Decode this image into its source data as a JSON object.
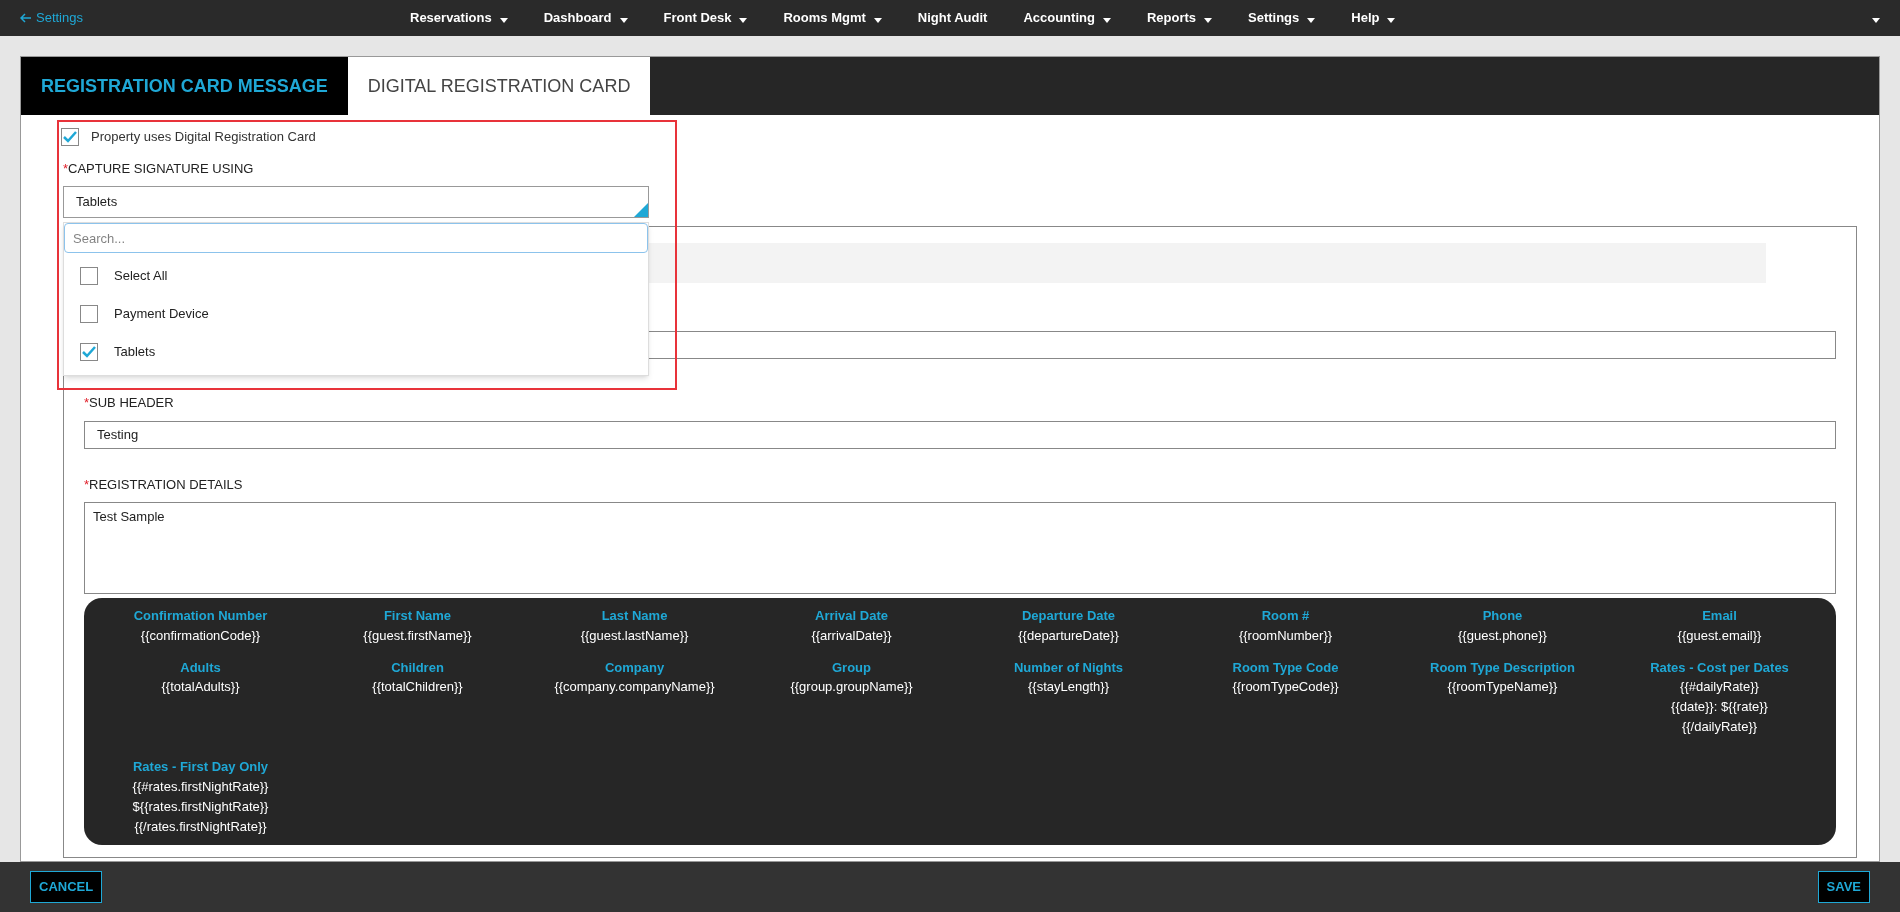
{
  "nav": {
    "back_link": "Settings",
    "menus": [
      {
        "label": "Reservations",
        "has_menu": true
      },
      {
        "label": "Dashboard",
        "has_menu": true
      },
      {
        "label": "Front Desk",
        "has_menu": true
      },
      {
        "label": "Rooms Mgmt",
        "has_menu": true
      },
      {
        "label": "Night Audit",
        "has_menu": false
      },
      {
        "label": "Accounting",
        "has_menu": true
      },
      {
        "label": "Reports",
        "has_menu": true
      },
      {
        "label": "Settings",
        "has_menu": true
      },
      {
        "label": "Help",
        "has_menu": true
      }
    ]
  },
  "tabs": [
    {
      "label": "REGISTRATION CARD MESSAGE",
      "selected": false
    },
    {
      "label": "DIGITAL REGISTRATION CARD",
      "selected": true
    }
  ],
  "property_checkbox": {
    "label": "Property uses Digital Registration Card",
    "checked": true
  },
  "capture_field": {
    "marker": "*",
    "label": "CAPTURE SIGNATURE USING",
    "value": "Tablets"
  },
  "dropdown": {
    "placeholder": "Search...",
    "options": [
      {
        "label": "Select All",
        "checked": false
      },
      {
        "label": "Payment Device",
        "checked": false
      },
      {
        "label": "Tablets",
        "checked": true
      }
    ]
  },
  "sub_header": {
    "marker": "*",
    "label": "SUB HEADER",
    "value": "Testing"
  },
  "registration_details": {
    "marker": "*",
    "label": "REGISTRATION DETAILS",
    "value": "Test Sample"
  },
  "variables": [
    {
      "name": "Confirmation Number",
      "lines": [
        "{{confirmationCode}}"
      ]
    },
    {
      "name": "First Name",
      "lines": [
        "{{guest.firstName}}"
      ]
    },
    {
      "name": "Last Name",
      "lines": [
        "{{guest.lastName}}"
      ]
    },
    {
      "name": "Arrival Date",
      "lines": [
        "{{arrivalDate}}"
      ]
    },
    {
      "name": "Departure Date",
      "lines": [
        "{{departureDate}}"
      ]
    },
    {
      "name": "Room #",
      "lines": [
        "{{roomNumber}}"
      ]
    },
    {
      "name": "Phone",
      "lines": [
        "{{guest.phone}}"
      ]
    },
    {
      "name": "Email",
      "lines": [
        "{{guest.email}}"
      ]
    },
    {
      "name": "Adults",
      "lines": [
        "{{totalAdults}}"
      ]
    },
    {
      "name": "Children",
      "lines": [
        "{{totalChildren}}"
      ]
    },
    {
      "name": "Company",
      "lines": [
        "{{company.companyName}}"
      ]
    },
    {
      "name": "Group",
      "lines": [
        "{{group.groupName}}"
      ]
    },
    {
      "name": "Number of Nights",
      "lines": [
        "{{stayLength}}"
      ]
    },
    {
      "name": "Room Type Code",
      "lines": [
        "{{roomTypeCode}}"
      ]
    },
    {
      "name": "Room Type Description",
      "lines": [
        "{{roomTypeName}}"
      ]
    },
    {
      "name": "Rates - Cost per Dates",
      "lines": [
        "{{#dailyRate}}",
        "{{date}}: ${{rate}}",
        "{{/dailyRate}}"
      ]
    },
    {
      "name": "Rates - First Day Only",
      "lines": [
        "{{#rates.firstNightRate}}",
        "${{rates.firstNightRate}}",
        "{{/rates.firstNightRate}}"
      ]
    }
  ],
  "footer": {
    "cancel": "CANCEL",
    "save": "SAVE"
  }
}
